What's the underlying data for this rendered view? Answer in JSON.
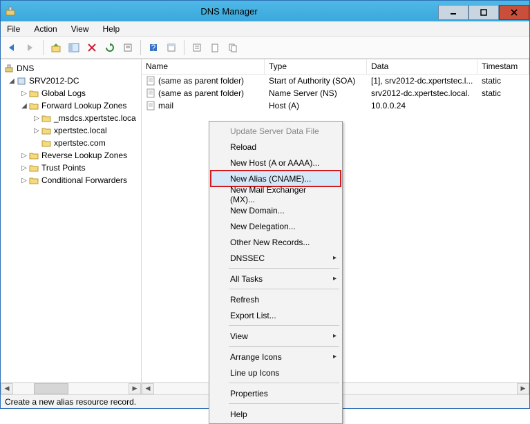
{
  "window": {
    "title": "DNS Manager"
  },
  "menubar": {
    "file": "File",
    "action": "Action",
    "view": "View",
    "help": "Help"
  },
  "tree": {
    "root": "DNS",
    "server": "SRV2012-DC",
    "global_logs": "Global Logs",
    "flz": "Forward Lookup Zones",
    "zone_msdcs": "_msdcs.xpertstec.loca",
    "zone_local": "xpertstec.local",
    "zone_com": "xpertstec.com",
    "rlz": "Reverse Lookup Zones",
    "trust": "Trust Points",
    "cond": "Conditional Forwarders"
  },
  "columns": {
    "name": "Name",
    "type": "Type",
    "data": "Data",
    "timestamp": "Timestam"
  },
  "records": [
    {
      "name": "(same as parent folder)",
      "type": "Start of Authority (SOA)",
      "data": "[1], srv2012-dc.xpertstec.l...",
      "timestamp": "static"
    },
    {
      "name": "(same as parent folder)",
      "type": "Name Server (NS)",
      "data": "srv2012-dc.xpertstec.local.",
      "timestamp": "static"
    },
    {
      "name": "mail",
      "type": "Host (A)",
      "data": "10.0.0.24",
      "timestamp": ""
    }
  ],
  "context_menu": {
    "update": "Update Server Data File",
    "reload": "Reload",
    "new_host": "New Host (A or AAAA)...",
    "new_alias": "New Alias (CNAME)...",
    "new_mx": "New Mail Exchanger (MX)...",
    "new_domain": "New Domain...",
    "new_delegation": "New Delegation...",
    "other_records": "Other New Records...",
    "dnssec": "DNSSEC",
    "all_tasks": "All Tasks",
    "refresh": "Refresh",
    "export": "Export List...",
    "view": "View",
    "arrange": "Arrange Icons",
    "lineup": "Line up Icons",
    "properties": "Properties",
    "help": "Help"
  },
  "statusbar": {
    "text": "Create a new alias resource record."
  }
}
